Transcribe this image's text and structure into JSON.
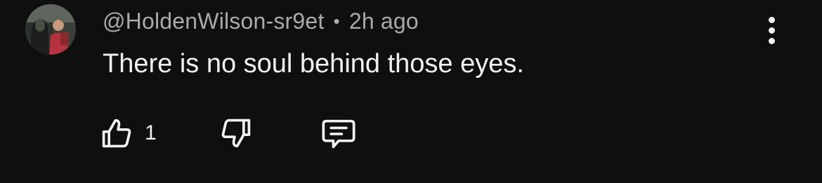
{
  "comment": {
    "author": "@HoldenWilson-sr9et",
    "separator": "•",
    "timestamp": "2h ago",
    "text": "There is no soul behind those eyes.",
    "like_count": "1"
  },
  "icons": {
    "avatar": "user-avatar-photo",
    "more": "more-vertical-icon",
    "like": "thumbs-up-icon",
    "dislike": "thumbs-down-icon",
    "reply": "reply-comment-icon"
  },
  "colors": {
    "background": "#0f0f0f",
    "text_primary": "#f1f1f1",
    "text_secondary": "#aaaaaa"
  }
}
